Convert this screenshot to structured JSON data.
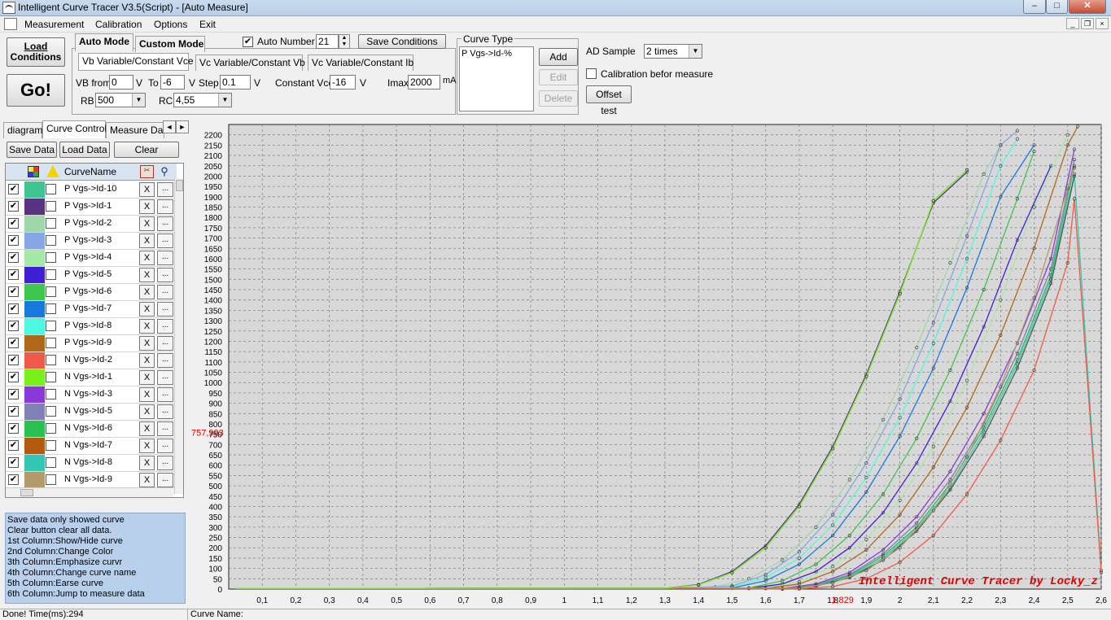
{
  "window": {
    "title": "Intelligent Curve Tracer V3.5(Script) - [Auto Measure]",
    "min": "–",
    "max": "□",
    "close": "✕"
  },
  "menu": [
    "Measurement",
    "Calibration",
    "Options",
    "Exit"
  ],
  "toolbar": {
    "load_conditions_line1": "Load",
    "load_conditions_line2": "Conditions",
    "go": "Go!",
    "mode_tabs": [
      "Auto Mode",
      "Custom Mode"
    ],
    "sub_tabs": [
      "Vb Variable/Constant Vce",
      "Vc Variable/Constant Vb",
      "Vc Variable/Constant Ib"
    ],
    "auto_number_label": "Auto Number",
    "auto_number_checked": true,
    "auto_number_value": "21",
    "save_conditions": "Save Conditions",
    "vb_from_label": "VB from",
    "vb_from_value": "0",
    "v1": "V",
    "to_label": "To",
    "to_value": "-6",
    "v2": "V",
    "step_label": "Step",
    "step_value": "0.1",
    "v3": "V",
    "constant_vce_label": "Constant Vce",
    "constant_vce_value": "-16",
    "v4": "V",
    "imax_label": "Imax",
    "imax_value": "2000",
    "imax_unit": "mA",
    "rb_label": "RB",
    "rb_value": "500",
    "rc_label": "RC",
    "rc_value": "4,55",
    "curve_type_label": "Curve Type",
    "curve_type_item": "P Vgs->Id-%",
    "add": "Add",
    "edit": "Edit",
    "delete": "Delete",
    "ad_sample_label": "AD Sample",
    "ad_sample_value": "2 times",
    "calibration_label": "Calibration befor measure",
    "calibration_checked": false,
    "offset_test": "Offset test"
  },
  "left": {
    "tabs": [
      "diagram",
      "Curve Control",
      "Measure Data"
    ],
    "tab_arrows": [
      "◄",
      "►"
    ],
    "save_data": "Save Data",
    "load_data": "Load Data",
    "clear": "Clear",
    "col_name": "CurveName",
    "x_label": "X",
    "dots_label": "...",
    "rows": [
      {
        "name": "P Vgs->Id-10",
        "color": "#3ec48e"
      },
      {
        "name": "P Vgs->Id-1",
        "color": "#5a3282"
      },
      {
        "name": "P Vgs->Id-2",
        "color": "#9ed8a8"
      },
      {
        "name": "P Vgs->Id-3",
        "color": "#86a6e6"
      },
      {
        "name": "P Vgs->Id-4",
        "color": "#a6e8a6"
      },
      {
        "name": "P Vgs->Id-5",
        "color": "#4020d6"
      },
      {
        "name": "P Vgs->Id-6",
        "color": "#3ec64e"
      },
      {
        "name": "P Vgs->Id-7",
        "color": "#1878e0"
      },
      {
        "name": "P Vgs->Id-8",
        "color": "#4ef8e0"
      },
      {
        "name": "P Vgs->Id-9",
        "color": "#b06818"
      },
      {
        "name": "N Vgs->Id-2",
        "color": "#f05a48"
      },
      {
        "name": "N Vgs->Id-1",
        "color": "#7af01a"
      },
      {
        "name": "N Vgs->Id-3",
        "color": "#8a38d8"
      },
      {
        "name": "N Vgs->Id-5",
        "color": "#7e80b6"
      },
      {
        "name": "N Vgs->Id-6",
        "color": "#28c050"
      },
      {
        "name": "N Vgs->Id-7",
        "color": "#b45a10"
      },
      {
        "name": "N Vgs->Id-8",
        "color": "#34c8b4"
      },
      {
        "name": "N Vgs->Id-9",
        "color": "#b49a6a"
      }
    ],
    "help": [
      "  Save data only showed curve",
      "  Clear button clear all data.",
      "1st Column:Show/Hide curve",
      "2nd Column:Change Color",
      "3th Column:Emphasize curvr",
      "4th Column:Change curve name",
      "5th Column:Earse curve",
      "6th Column:Jump to measure data"
    ]
  },
  "status": {
    "left": "Done!  Time(ms):294",
    "right": "Curve Name:"
  },
  "chart_data": {
    "type": "line",
    "xlim": [
      0,
      2.6
    ],
    "ylim": [
      0,
      2250
    ],
    "xticks": [
      "0,1",
      "0,2",
      "0,3",
      "0,4",
      "0,5",
      "0,6",
      "0,7",
      "0,8",
      "0,9",
      "1",
      "1,1",
      "1,2",
      "1,3",
      "1,4",
      "1,5",
      "1,6",
      "1,7",
      "1,8",
      "1,9",
      "2",
      "2,1",
      "2,2",
      "2,3",
      "2,4",
      "2,5",
      "2,6"
    ],
    "yticks": [
      0,
      50,
      100,
      150,
      200,
      250,
      300,
      350,
      400,
      450,
      500,
      550,
      600,
      650,
      700,
      750,
      800,
      850,
      900,
      950,
      1000,
      1050,
      1100,
      1150,
      1200,
      1250,
      1300,
      1350,
      1400,
      1450,
      1500,
      1550,
      1600,
      1650,
      1700,
      1750,
      1800,
      1850,
      1900,
      1950,
      2000,
      2050,
      2100,
      2150,
      2200
    ],
    "cursor_y_label": "757,993",
    "cursor_x_label": "1,829",
    "watermark": "Intelligent Curve Tracer by Locky_z",
    "grid": true,
    "series": [
      {
        "color": "#3ec48e",
        "x": [
          1.4,
          1.5,
          1.6,
          1.7,
          1.8,
          1.9,
          2.0,
          2.1,
          2.2
        ],
        "y": [
          20,
          80,
          200,
          400,
          680,
          1030,
          1430,
          1880,
          2030
        ]
      },
      {
        "color": "#5a3282",
        "x": [
          1.4,
          1.5,
          1.6,
          1.7,
          1.8,
          1.9,
          2.0,
          2.1,
          2.2
        ],
        "y": [
          22,
          85,
          210,
          410,
          690,
          1040,
          1440,
          1870,
          2020
        ]
      },
      {
        "color": "#9ed8a8",
        "x": [
          1.45,
          1.55,
          1.65,
          1.75,
          1.85,
          1.95,
          2.05,
          2.15,
          2.25,
          2.3
        ],
        "y": [
          10,
          50,
          140,
          300,
          530,
          820,
          1170,
          1580,
          2010,
          2150
        ]
      },
      {
        "color": "#86a6e6",
        "x": [
          1.5,
          1.6,
          1.7,
          1.8,
          1.9,
          2.0,
          2.1,
          2.2,
          2.3,
          2.35
        ],
        "y": [
          15,
          70,
          180,
          360,
          610,
          920,
          1290,
          1710,
          2150,
          2220
        ]
      },
      {
        "color": "#4ef8e0",
        "x": [
          1.5,
          1.6,
          1.7,
          1.8,
          1.9,
          2.0,
          2.1,
          2.2,
          2.3,
          2.35
        ],
        "y": [
          10,
          55,
          150,
          310,
          540,
          830,
          1190,
          1600,
          2050,
          2180
        ]
      },
      {
        "color": "#1878e0",
        "x": [
          1.5,
          1.6,
          1.7,
          1.8,
          1.9,
          2.0,
          2.1,
          2.2,
          2.3,
          2.4
        ],
        "y": [
          5,
          40,
          120,
          260,
          470,
          740,
          1070,
          1460,
          1900,
          2150
        ]
      },
      {
        "color": "#3ec64e",
        "x": [
          1.55,
          1.65,
          1.75,
          1.85,
          1.95,
          2.05,
          2.15,
          2.25,
          2.35,
          2.4
        ],
        "y": [
          5,
          40,
          120,
          260,
          460,
          730,
          1060,
          1450,
          1890,
          2120
        ]
      },
      {
        "color": "#4020d6",
        "x": [
          1.55,
          1.65,
          1.75,
          1.85,
          1.95,
          2.05,
          2.15,
          2.25,
          2.35,
          2.45
        ],
        "y": [
          3,
          25,
          85,
          200,
          370,
          610,
          910,
          1270,
          1690,
          2050
        ]
      },
      {
        "color": "#a6e8a6",
        "x": [
          1.6,
          1.7,
          1.8,
          1.9,
          2.0,
          2.1,
          2.2,
          2.3,
          2.4,
          2.5
        ],
        "y": [
          5,
          35,
          110,
          240,
          430,
          690,
          1010,
          1400,
          1850,
          2200
        ]
      },
      {
        "color": "#b06818",
        "x": [
          1.6,
          1.7,
          1.8,
          1.9,
          2.0,
          2.1,
          2.2,
          2.3,
          2.4,
          2.5,
          2.53
        ],
        "y": [
          3,
          25,
          85,
          190,
          360,
          590,
          880,
          1230,
          1650,
          2150,
          2240
        ]
      },
      {
        "color": "#8a38d8",
        "x": [
          1.65,
          1.75,
          1.85,
          1.95,
          2.05,
          2.15,
          2.25,
          2.35,
          2.45,
          2.52
        ],
        "y": [
          3,
          25,
          80,
          190,
          350,
          570,
          850,
          1190,
          1600,
          2130
        ]
      },
      {
        "color": "#7e80b6",
        "x": [
          1.65,
          1.75,
          1.85,
          1.95,
          2.05,
          2.15,
          2.25,
          2.35,
          2.45,
          2.52
        ],
        "y": [
          2,
          20,
          70,
          170,
          320,
          530,
          800,
          1140,
          1550,
          2080
        ]
      },
      {
        "color": "#28c050",
        "x": [
          1.65,
          1.75,
          1.85,
          1.95,
          2.05,
          2.15,
          2.25,
          2.35,
          2.45,
          2.52
        ],
        "y": [
          2,
          18,
          65,
          160,
          300,
          510,
          780,
          1110,
          1520,
          2050
        ]
      },
      {
        "color": "#34c8b4",
        "x": [
          1.65,
          1.75,
          1.85,
          1.95,
          2.05,
          2.15,
          2.25,
          2.35,
          2.45,
          2.52,
          2.6
        ],
        "y": [
          1,
          15,
          60,
          150,
          290,
          490,
          760,
          1090,
          1500,
          2010,
          90
        ]
      },
      {
        "color": "#555555",
        "x": [
          1.65,
          1.75,
          1.85,
          1.95,
          2.05,
          2.15,
          2.25,
          2.35,
          2.45,
          2.52
        ],
        "y": [
          1,
          14,
          55,
          140,
          280,
          480,
          740,
          1070,
          1480,
          2000
        ]
      },
      {
        "color": "#b49a6a",
        "x": [
          1.7,
          1.8,
          1.9,
          2.0,
          2.1,
          2.2,
          2.3,
          2.4,
          2.5,
          2.52
        ],
        "y": [
          5,
          30,
          90,
          200,
          380,
          640,
          980,
          1410,
          1940,
          2040
        ]
      },
      {
        "color": "#f05a48",
        "x": [
          1.7,
          1.8,
          1.9,
          2.0,
          2.1,
          2.2,
          2.3,
          2.4,
          2.5,
          2.52,
          2.6
        ],
        "y": [
          1,
          12,
          50,
          130,
          260,
          460,
          720,
          1060,
          1580,
          1890,
          80
        ]
      },
      {
        "color": "#7af01a",
        "x": [
          1.4,
          1.5,
          1.6,
          1.7,
          1.8,
          1.9,
          2.0,
          2.1,
          2.2
        ],
        "y": [
          20,
          80,
          200,
          400,
          680,
          1030,
          1430,
          1880,
          2030
        ]
      }
    ]
  }
}
